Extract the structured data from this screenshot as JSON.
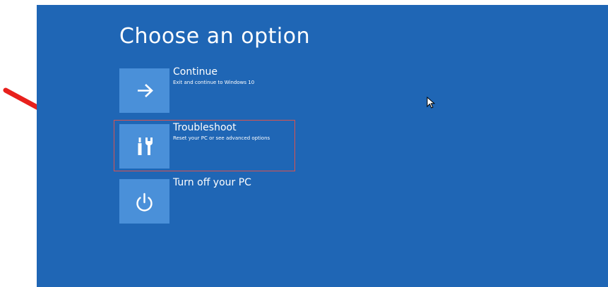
{
  "screen": {
    "title": "Choose an option",
    "background_color": "#1f66b5",
    "tile_color": "#4a90d9"
  },
  "options": [
    {
      "id": "continue",
      "label": "Continue",
      "description": "Exit and continue to Windows 10",
      "icon": "arrow-right-icon"
    },
    {
      "id": "troubleshoot",
      "label": "Troubleshoot",
      "description": "Reset your PC or see advanced options",
      "icon": "tools-icon",
      "highlighted": true
    },
    {
      "id": "turn-off",
      "label": "Turn off your PC",
      "description": "",
      "icon": "power-icon"
    }
  ],
  "annotations": {
    "arrow_color": "#e8201c",
    "highlight_color": "#d9534f"
  }
}
